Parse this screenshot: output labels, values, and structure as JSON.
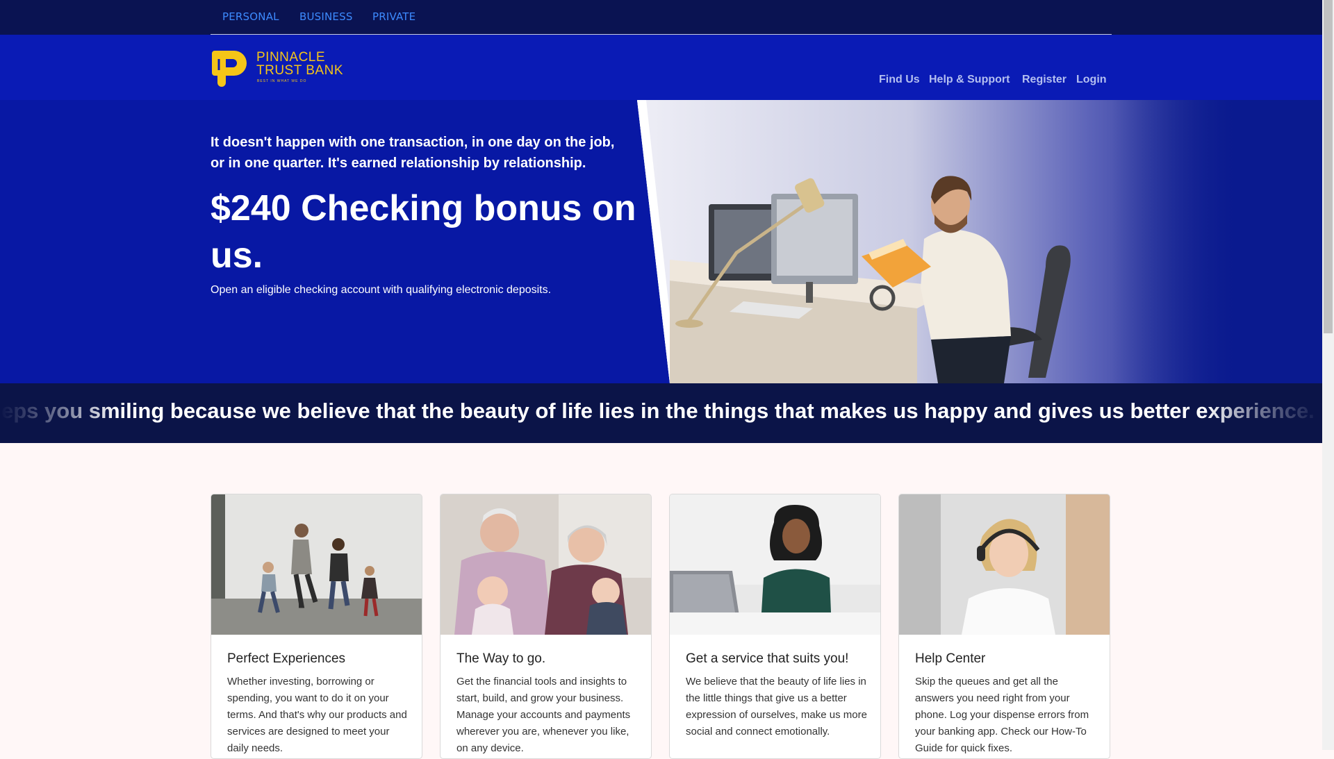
{
  "topnav": {
    "items": [
      "PERSONAL",
      "BUSINESS",
      "PRIVATE"
    ]
  },
  "brand": {
    "line1": "PINNACLE",
    "line2": "TRUST BANK",
    "tagline": "BEST IN WHAT WE DO",
    "colors": {
      "accent": "#f5c518",
      "nav_bg": "#0a1352",
      "header_bg": "#0a1bb5",
      "hero_bg": "#0818a4"
    }
  },
  "header_nav": {
    "items": [
      "Find Us",
      "Help & Support",
      "Register",
      "Login"
    ]
  },
  "hero": {
    "intro": "It doesn't happen with one transaction, in one day on the job, or in one quarter. It's earned relationship by relationship.",
    "title": "$240 Checking bonus on us.",
    "subtitle": "Open an eligible checking account with qualifying electronic deposits."
  },
  "marquee": {
    "text": "eps you smiling because we believe that the beauty of life lies in the things that makes us happy and gives us better experience.  W"
  },
  "cards": [
    {
      "title": "Perfect Experiences",
      "body": "Whether investing, borrowing or spending, you want to do it on your terms. And that's why our products and services are designed to meet your daily needs."
    },
    {
      "title": "The Way to go.",
      "body": "Get the financial tools and insights to start, build, and grow your business. Manage your accounts and payments wherever you are, whenever you like, on any device."
    },
    {
      "title": "Get a service that suits you!",
      "body": "We believe that the beauty of life lies in the little things that give us a better expression of ourselves, make us more social and connect emotionally."
    },
    {
      "title": "Help Center",
      "body": "Skip the queues and get all the answers you need right from your phone. Log your dispense errors from your banking app. Check our How-To Guide for quick fixes."
    }
  ]
}
